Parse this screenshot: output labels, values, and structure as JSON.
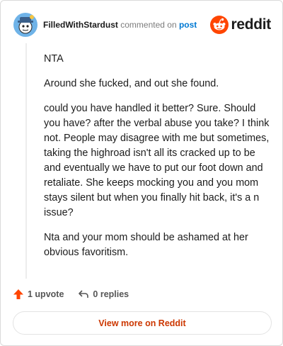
{
  "comment": {
    "username": "FilledWithStardust",
    "action_text": "commented on",
    "post_link": "post",
    "paragraphs": [
      "NTA",
      "Around she fucked, and out she found.",
      "could you have handled it better? Sure. Should you have? after the verbal abuse you take? I think not. People may disagree with me but sometimes, taking the highroad isn't all its cracked up to be and eventually we have to put our foot down and retaliate. She keeps mocking you and you mom stays silent but when you finally hit back, it's a n issue?",
      "Nta and your mom should be ashamed at her obvious favoritism."
    ]
  },
  "brand": {
    "name": "reddit",
    "color": "#ff4500"
  },
  "footer": {
    "upvotes": "1 upvote",
    "replies": "0 replies",
    "view_more": "View more on Reddit"
  },
  "icons": [
    "avatar",
    "reddit-logo-icon",
    "upvote-arrow-icon",
    "reply-icon"
  ]
}
